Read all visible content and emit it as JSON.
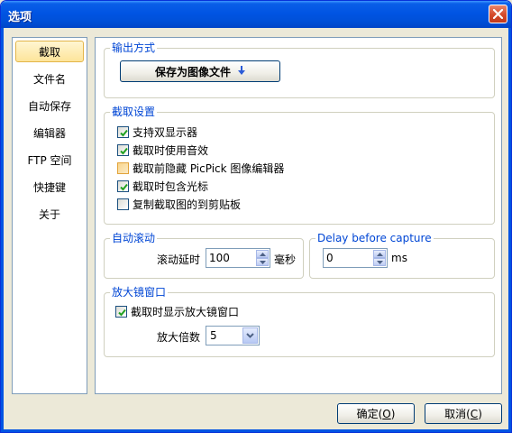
{
  "window": {
    "title": "选项"
  },
  "sidebar": {
    "items": [
      {
        "label": "截取",
        "selected": true
      },
      {
        "label": "文件名"
      },
      {
        "label": "自动保存"
      },
      {
        "label": "编辑器"
      },
      {
        "label": "FTP 空间"
      },
      {
        "label": "快捷键"
      },
      {
        "label": "关于"
      }
    ]
  },
  "output": {
    "legend": "输出方式",
    "save_button": "保存为图像文件"
  },
  "capture": {
    "legend": "截取设置",
    "options": [
      {
        "label": "支持双显示器",
        "checked": true
      },
      {
        "label": "截取时使用音效",
        "checked": true
      },
      {
        "label": "截取前隐藏 PicPick 图像编辑器",
        "checked": false
      },
      {
        "label": "截取时包含光标",
        "checked": true
      },
      {
        "label": "复制截取图的到剪贴板",
        "checked": false
      }
    ]
  },
  "autoscroll": {
    "legend": "自动滚动",
    "delay_label": "滚动延时",
    "delay_value": "100",
    "unit": "毫秒"
  },
  "delay": {
    "legend": "Delay before capture",
    "value": "0",
    "unit": "ms"
  },
  "magnifier": {
    "legend": "放大镜窗口",
    "show_label": "截取时显示放大镜窗口",
    "show_checked": true,
    "zoom_label": "放大倍数",
    "zoom_value": "5"
  },
  "footer": {
    "ok_text": "确定(",
    "ok_key": "O",
    "ok_end": ")",
    "cancel_text": "取消(",
    "cancel_key": "C",
    "cancel_end": ")"
  },
  "colors": {
    "titlebar": "#0054e3",
    "legend": "#0046d5",
    "selected_nav": "#fde49a"
  }
}
